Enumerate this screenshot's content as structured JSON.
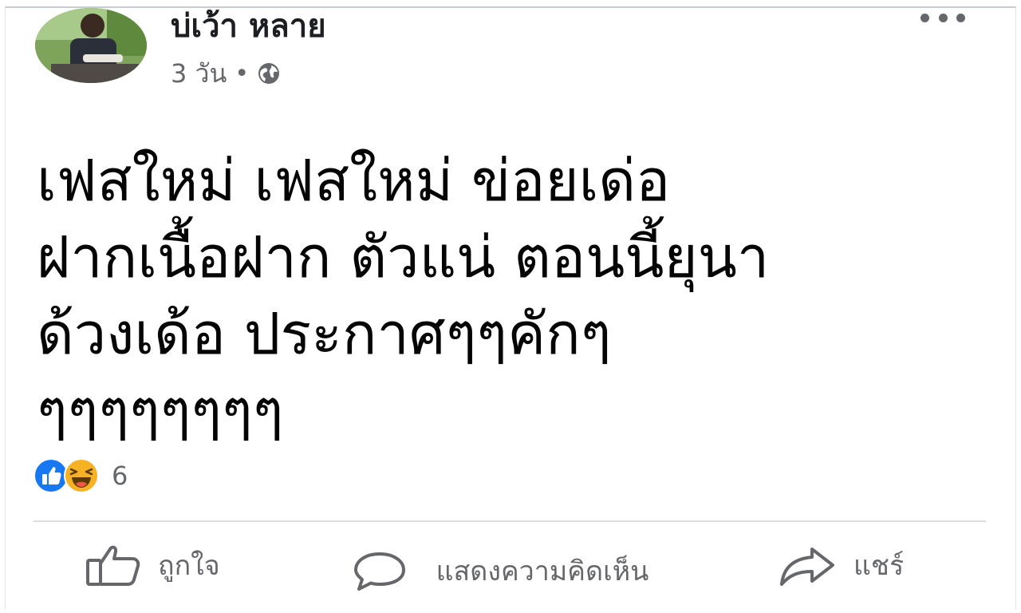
{
  "post": {
    "author": "บ่เว้า หลาย",
    "time": "3 วัน",
    "separator": "•",
    "privacy_icon": "globe-icon",
    "more_icon": "more-horizontal-icon",
    "text": "เฟสใหม่ เฟสใหม่ ข่อยเด่อ\nฝากเนื้อฝาก ตัวแน่ ตอนนี้ยุนา\nด้วงเด้อ ประกาศๆๆคักๆ\nๆๆๆๆๆๆๆๆ"
  },
  "reactions": {
    "icons": [
      "like-reaction-icon",
      "haha-reaction-icon"
    ],
    "count": "6",
    "like_color": "#1877f2",
    "haha_color": "#f7b125"
  },
  "actions": {
    "like_label": "ถูกใจ",
    "comment_label": "แสดงความคิดเห็น",
    "share_label": "แชร์"
  }
}
